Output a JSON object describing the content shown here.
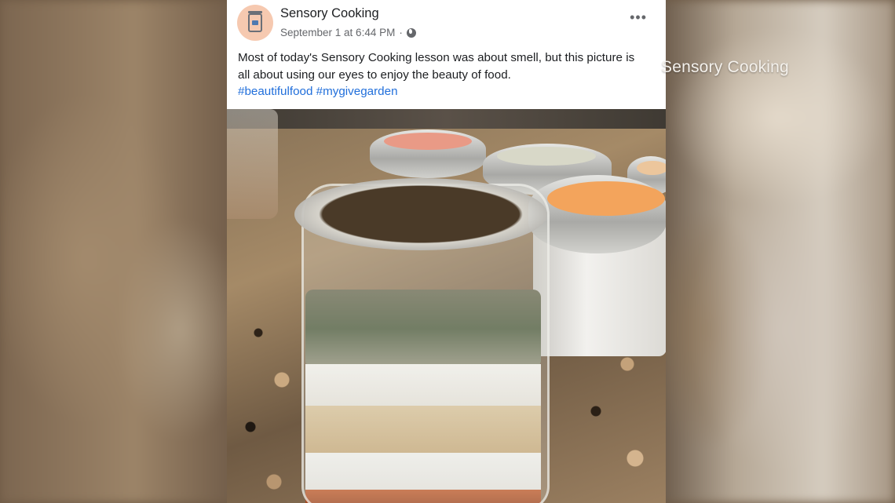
{
  "overlay": {
    "caption": "Sensory Cooking"
  },
  "post": {
    "page_name": "Sensory Cooking",
    "timestamp": "September 1 at 6:44 PM",
    "separator": "·",
    "audience_icon": "globe-icon",
    "more_icon": "more-horizontal-icon",
    "more_label": "•••",
    "text": "Most of today's Sensory Cooking lesson was about smell, but this picture is all about using our eyes to enjoy the beauty of food.",
    "hashtags": [
      "#beautifulfood",
      "#mygivegarden"
    ],
    "colors": {
      "link": "#216fdb",
      "secondary_text": "#65676b",
      "avatar_bg": "#f6c9b0"
    }
  }
}
